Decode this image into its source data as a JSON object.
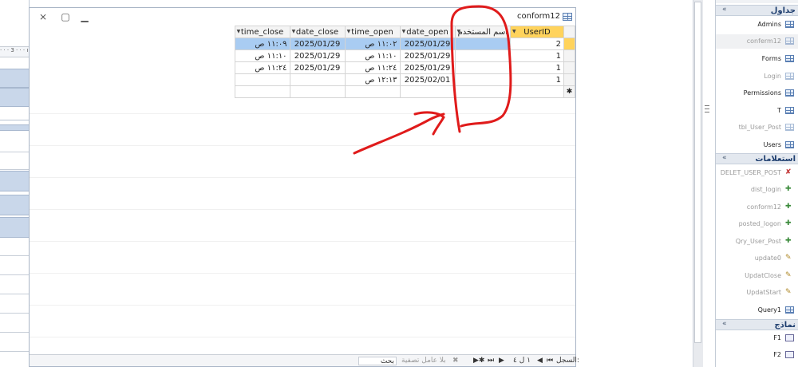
{
  "window": {
    "title": "conform12",
    "close_glyph": "⨯",
    "restore_glyph": "▢",
    "minimize_glyph": "▁"
  },
  "sheet": {
    "columns": [
      {
        "key": "time_close",
        "label": "time_close"
      },
      {
        "key": "date_close",
        "label": "date_close"
      },
      {
        "key": "time_open",
        "label": "time_open"
      },
      {
        "key": "date_open",
        "label": "date_open"
      },
      {
        "key": "username",
        "label": "اسم المستخدم"
      },
      {
        "key": "userid",
        "label": "UserID"
      }
    ],
    "rows": [
      {
        "time_close": "١١:٠٩ ص",
        "date_close": "2025/01/29",
        "time_open": "١١:٠٢ ص",
        "date_open": "2025/01/29",
        "username": "",
        "userid": "2"
      },
      {
        "time_close": "١١:١٠ ص",
        "date_close": "2025/01/29",
        "time_open": "١١:١٠ ص",
        "date_open": "2025/01/29",
        "username": "",
        "userid": "1"
      },
      {
        "time_close": "١١:٢٤ ص",
        "date_close": "2025/01/29",
        "time_open": "١١:٢٤ ص",
        "date_open": "2025/01/29",
        "username": "",
        "userid": "1"
      },
      {
        "time_close": "",
        "date_close": "",
        "time_open": "١٢:١٣ ص",
        "date_open": "2025/02/01",
        "username": "",
        "userid": "1"
      }
    ],
    "new_row_marker": "✱"
  },
  "record_nav": {
    "label": "السجل:",
    "position": "١ ل ٤",
    "first": "⏮",
    "prev": "◀",
    "next": "▶",
    "last": "⏭",
    "new": "▶✱",
    "filter": "بلا عامل تصفية",
    "search": "بحث"
  },
  "left_form": {
    "ruler": "· · · 3 · · · ı · ·"
  },
  "nav_pane": {
    "groups": [
      {
        "title": "جداول",
        "chevron": "«",
        "items": [
          {
            "label": "Admins",
            "type": "table",
            "dim": false
          },
          {
            "label": "conferm12",
            "type": "table",
            "dim": true,
            "hl": true
          },
          {
            "label": "Forms",
            "type": "table",
            "dim": false
          },
          {
            "label": "Login",
            "type": "table",
            "dim": true
          },
          {
            "label": "Permissions",
            "type": "table",
            "dim": false
          },
          {
            "label": "T",
            "type": "table",
            "dim": false
          },
          {
            "label": "tbl_User_Post",
            "type": "table",
            "dim": true
          },
          {
            "label": "Users",
            "type": "table",
            "dim": false
          }
        ]
      },
      {
        "title": "استعلامات",
        "chevron": "«",
        "items": [
          {
            "label": "DELET_USER_POST",
            "type": "del",
            "dim": true
          },
          {
            "label": "dist_login",
            "type": "sel",
            "dim": true
          },
          {
            "label": "conform12",
            "type": "sel",
            "dim": true
          },
          {
            "label": "posted_logon",
            "type": "app",
            "dim": true
          },
          {
            "label": "Qry_User_Post",
            "type": "app",
            "dim": true
          },
          {
            "label": "update0",
            "type": "upd",
            "dim": true
          },
          {
            "label": "UpdatClose",
            "type": "upd",
            "dim": true
          },
          {
            "label": "UpdatStart",
            "type": "upd",
            "dim": true
          },
          {
            "label": "Query1",
            "type": "select",
            "dim": false
          }
        ]
      },
      {
        "title": "نماذج",
        "chevron": "«",
        "items": [
          {
            "label": "F1",
            "type": "form",
            "dim": false
          },
          {
            "label": "F2",
            "type": "form",
            "dim": false
          }
        ]
      }
    ]
  },
  "colors": {
    "annotation": "#e01b1b",
    "selected_row": "#a9ccf2",
    "active_header": "#ffd35c"
  }
}
